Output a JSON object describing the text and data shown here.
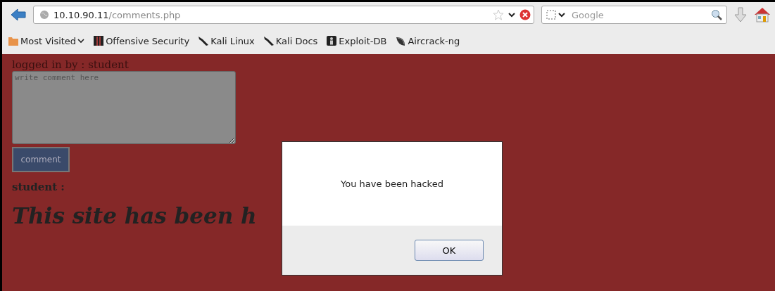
{
  "toolbar": {
    "url_host": "10.10.90.11",
    "url_path": "/comments.php",
    "search": {
      "placeholder": "Google"
    }
  },
  "bookmarks": [
    {
      "label": "Most Visited",
      "kind": "folder"
    },
    {
      "label": "Offensive Security",
      "kind": "offsec"
    },
    {
      "label": "Kali Linux",
      "kind": "kali"
    },
    {
      "label": "Kali Docs",
      "kind": "kali"
    },
    {
      "label": "Exploit-DB",
      "kind": "exploit"
    },
    {
      "label": "Aircrack-ng",
      "kind": "aircrack"
    }
  ],
  "page": {
    "login_text": "logged in by : student",
    "comment_field": {
      "placeholder": "write comment here"
    },
    "submit_label": "comment",
    "author": "student :",
    "comment": "This site has been h"
  },
  "dialog": {
    "message": "You have been hacked",
    "button": "OK"
  }
}
